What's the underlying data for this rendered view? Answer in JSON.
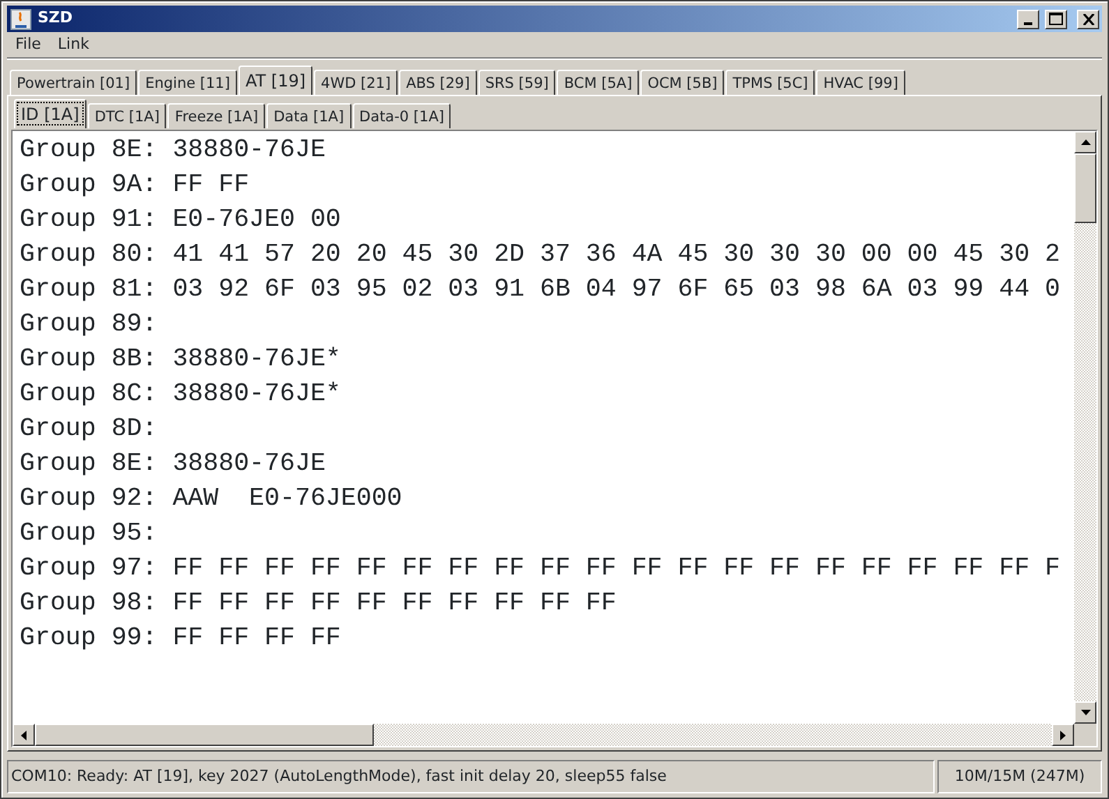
{
  "window": {
    "title": "SZD"
  },
  "menu": [
    "File",
    "Link"
  ],
  "tabs": [
    {
      "label": "Powertrain [01]",
      "selected": false
    },
    {
      "label": "Engine [11]",
      "selected": false
    },
    {
      "label": "AT [19]",
      "selected": true
    },
    {
      "label": "4WD [21]",
      "selected": false
    },
    {
      "label": "ABS [29]",
      "selected": false
    },
    {
      "label": "SRS [59]",
      "selected": false
    },
    {
      "label": "BCM [5A]",
      "selected": false
    },
    {
      "label": "OCM [5B]",
      "selected": false
    },
    {
      "label": "TPMS [5C]",
      "selected": false
    },
    {
      "label": "HVAC [99]",
      "selected": false
    }
  ],
  "subtabs": [
    {
      "label": "ID [1A]",
      "selected": true
    },
    {
      "label": "DTC [1A]",
      "selected": false
    },
    {
      "label": "Freeze [1A]",
      "selected": false
    },
    {
      "label": "Data [1A]",
      "selected": false
    },
    {
      "label": "Data-0 [1A]",
      "selected": false
    }
  ],
  "lines": [
    "Group 8E: 38880-76JE",
    "Group 9A: FF FF",
    "Group 91: E0-76JE0 00",
    "Group 80: 41 41 57 20 20 45 30 2D 37 36 4A 45 30 30 30 00 00 45 30 2",
    "Group 81: 03 92 6F 03 95 02 03 91 6B 04 97 6F 65 03 98 6A 03 99 44 0",
    "Group 89:",
    "Group 8B: 38880-76JE*",
    "Group 8C: 38880-76JE*",
    "Group 8D:",
    "Group 8E: 38880-76JE",
    "Group 92: AAW  E0-76JE000",
    "Group 95:",
    "Group 97: FF FF FF FF FF FF FF FF FF FF FF FF FF FF FF FF FF FF FF F",
    "Group 98: FF FF FF FF FF FF FF FF FF FF",
    "Group 99: FF FF FF FF"
  ],
  "status_bar": {
    "message": "COM10: Ready: AT [19], key 2027 (AutoLengthMode), fast init delay 20, sleep55 false",
    "memory": "10M/15M (247M)"
  }
}
